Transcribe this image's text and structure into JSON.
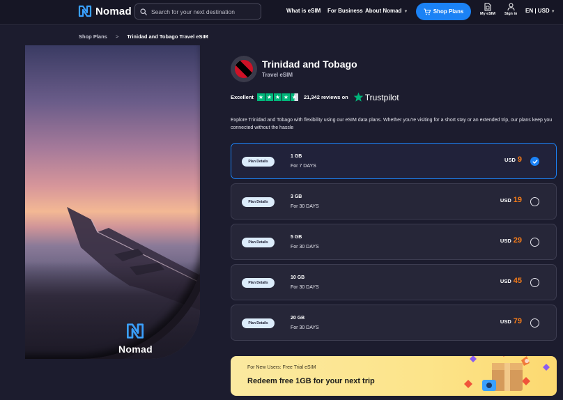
{
  "nav": {
    "logo_text": "Nomad",
    "search_placeholder": "Search for your next destination",
    "links": [
      "What is eSIM",
      "For Business",
      "About Nomad"
    ],
    "shop_label": "Shop Plans",
    "my_esim_label": "My eSIM",
    "sign_in_label": "Sign in",
    "lang_label": "EN | USD"
  },
  "breadcrumb": {
    "parent": "Shop Plans",
    "separator": ">",
    "current": "Trinidad and Tobago Travel eSIM"
  },
  "hero": {
    "brand_text": "Nomad"
  },
  "country": {
    "title": "Trinidad and Tobago",
    "subtitle": "Travel eSIM"
  },
  "rating": {
    "label": "Excellent",
    "stars": 4.5,
    "reviews_text": "21,342 reviews on",
    "provider": "Trustpilot"
  },
  "description": "Explore Trinidad and Tobago with flexibility using our eSIM data plans. Whether you're visiting for a short stay or an extended trip, our plans keep you connected without the hassle",
  "plans": [
    {
      "details": "Plan Details",
      "data": "1 GB",
      "days": "For 7 DAYS",
      "currency": "USD",
      "price": "9",
      "selected": true
    },
    {
      "details": "Plan Details",
      "data": "3 GB",
      "days": "For 30 DAYS",
      "currency": "USD",
      "price": "19",
      "selected": false
    },
    {
      "details": "Plan Details",
      "data": "5 GB",
      "days": "For 30 DAYS",
      "currency": "USD",
      "price": "29",
      "selected": false
    },
    {
      "details": "Plan Details",
      "data": "10 GB",
      "days": "For 30 DAYS",
      "currency": "USD",
      "price": "45",
      "selected": false
    },
    {
      "details": "Plan Details",
      "data": "20 GB",
      "days": "For 30 DAYS",
      "currency": "USD",
      "price": "79",
      "selected": false
    }
  ],
  "promo": {
    "small": "For New Users: Free Trial eSIM",
    "big": "Redeem free 1GB for your next trip"
  },
  "colors": {
    "accent": "#1b82f5",
    "price": "#f77d1a",
    "trustpilot": "#00b67a",
    "background": "#1c1c2e"
  },
  "icons": {
    "search": "search-icon",
    "shop": "cart-icon",
    "my_esim": "sim-icon",
    "sign_in": "user-icon",
    "check": "check-icon"
  }
}
